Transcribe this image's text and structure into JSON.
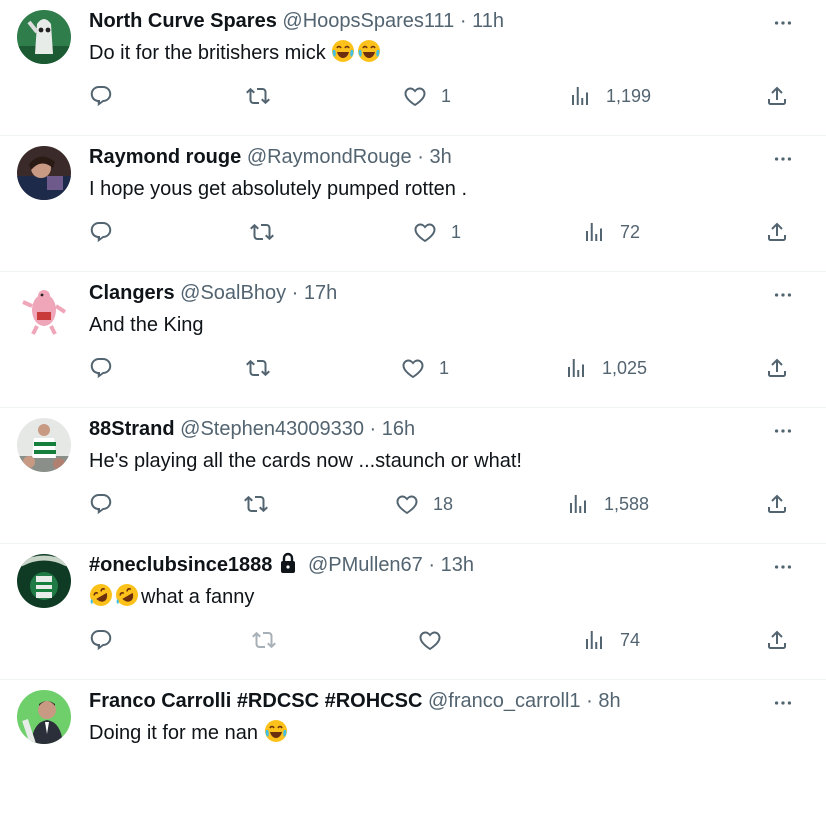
{
  "tweets": [
    {
      "name": "North Curve Spares",
      "handle": "@HoopsSpares111",
      "time": "11h",
      "text": "Do it for the britishers mick",
      "emojis": [
        "tears-of-joy",
        "tears-of-joy"
      ],
      "likes": "1",
      "views": "1,199",
      "avatar": "ghost-avatar"
    },
    {
      "name": "Raymond rouge",
      "handle": "@RaymondRouge",
      "time": "3h",
      "text": "I hope yous get absolutely pumped rotten .",
      "likes": "1",
      "views": "72",
      "avatar": "person-photo-avatar"
    },
    {
      "name": "Clangers",
      "handle": "@SoalBhoy",
      "time": "17h",
      "text": "And the King",
      "likes": "1",
      "views": "1,025",
      "avatar": "pink-clanger-avatar"
    },
    {
      "name": "88Strand",
      "handle": "@Stephen43009330",
      "time": "16h",
      "text": "He's playing all the cards now ...staunch or what!",
      "likes": "18",
      "views": "1,588",
      "avatar": "footballer-avatar"
    },
    {
      "name": "#oneclubsince1888",
      "handle": "@PMullen67",
      "time": "13h",
      "text": "what a fanny",
      "emojis_before": [
        "rolling-laughing",
        "rolling-laughing"
      ],
      "likes": "",
      "views": "74",
      "protected": true,
      "avatar": "green-crest-avatar"
    },
    {
      "name": "Franco Carrolli #RDCSC #ROHCSC",
      "handle": "@franco_carroll1",
      "time": "8h",
      "text": "Doing it for me nan",
      "emojis": [
        "tears-of-joy"
      ],
      "avatar": "man-green-avatar"
    }
  ],
  "separator": "·",
  "colors": {
    "text": "#0f1419",
    "muted": "#536471",
    "border": "#eff3f4"
  }
}
